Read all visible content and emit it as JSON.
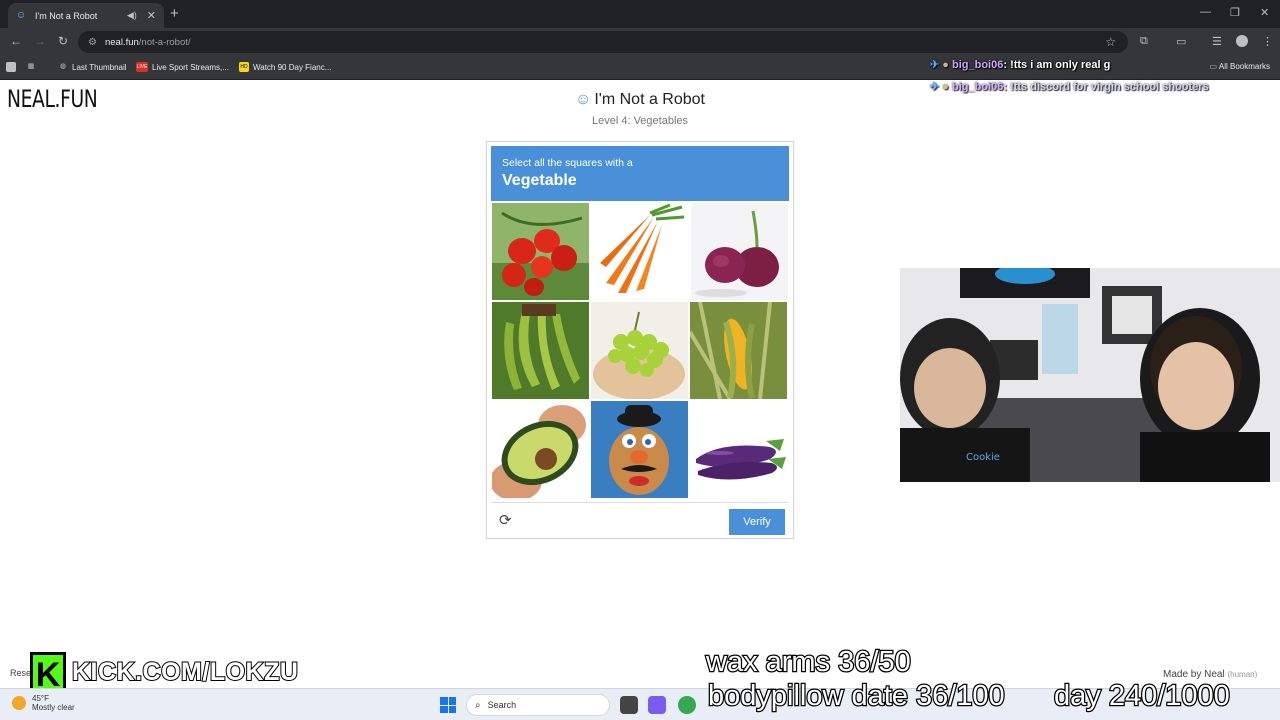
{
  "browser": {
    "tab_title": "I'm Not a Robot",
    "tab_close": "✕",
    "new_tab": "+",
    "url_host": "neal.fun",
    "url_path": "/not-a-robot/",
    "bookmarks": [
      {
        "label": "Last Thumbnail",
        "icon": "globe-icon"
      },
      {
        "label": "Live Sport Streams,...",
        "icon": "live-icon",
        "icon_text": "LIVE"
      },
      {
        "label": "Watch 90 Day Fianc...",
        "icon": "hd-icon",
        "icon_text": "HD"
      }
    ],
    "all_bookmarks": "All Bookmarks"
  },
  "page": {
    "logo": "NEAL.FUN",
    "title": "I'm Not a Robot",
    "subtitle": "Level 4: Vegetables"
  },
  "captcha": {
    "instruction": "Select all the squares with a",
    "target": "Vegetable",
    "tiles": [
      {
        "name": "tile-tomatoes",
        "subject": "tomatoes"
      },
      {
        "name": "tile-carrots",
        "subject": "carrots"
      },
      {
        "name": "tile-red-onions",
        "subject": "red onions"
      },
      {
        "name": "tile-bananas",
        "subject": "green bananas"
      },
      {
        "name": "tile-grapes",
        "subject": "green grapes"
      },
      {
        "name": "tile-corn",
        "subject": "corn"
      },
      {
        "name": "tile-avocado",
        "subject": "avocado"
      },
      {
        "name": "tile-mr-potato-head",
        "subject": "Mr. Potato Head toy"
      },
      {
        "name": "tile-eggplants",
        "subject": "eggplants"
      }
    ],
    "verify_label": "Verify",
    "reload_icon": "refresh-icon"
  },
  "chat": [
    {
      "user": "big_boi06",
      "message": " !tts i am only real g"
    },
    {
      "user": "big_boi06",
      "message": " !tts discord for virgin school shooters"
    }
  ],
  "overlay": {
    "kick_letter": "K",
    "kick_url": "KICK.COM/LOKZU",
    "wax_arms": "wax arms 36/50",
    "bodypillow": "bodypillow date 36/100",
    "day": "day 240/1000",
    "made_by": "Made by Neal",
    "made_by_note": "(human)"
  },
  "taskbar": {
    "res_label": "Rese",
    "temperature": "45°F",
    "weather": "Mostly clear",
    "search_placeholder": "Search"
  },
  "colors": {
    "accent": "#4a90d9",
    "kick_green": "#53fc18",
    "chrome_dark": "#202124",
    "chrome_mid": "#35363a"
  }
}
